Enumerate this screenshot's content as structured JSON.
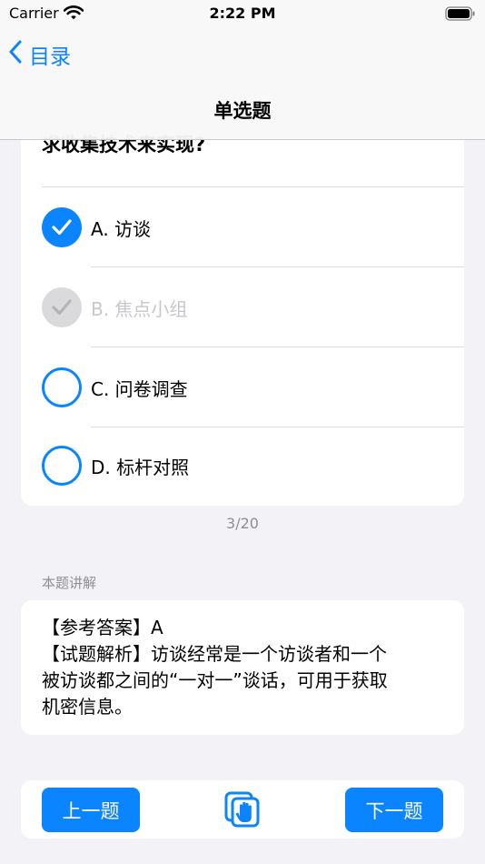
{
  "status_bar": {
    "carrier": "Carrier",
    "time": "2:22 PM"
  },
  "nav": {
    "back_label": "目录",
    "title": "单选题"
  },
  "question": {
    "lines": [
      "求收集技术来实现?"
    ]
  },
  "options": [
    {
      "label": "A. 访谈",
      "state": "checked"
    },
    {
      "label": "B. 焦点小组",
      "state": "disabled"
    },
    {
      "label": "C. 问卷调查",
      "state": "empty"
    },
    {
      "label": "D. 标杆对照",
      "state": "empty"
    }
  ],
  "progress": "3/20",
  "explanation": {
    "header": "本题讲解",
    "lines": [
      "【参考答案】A",
      "【试题解析】访谈经常是一个访谈者和一个",
      "被访谈都之间的“一对一”谈话，可用于获取",
      "机密信息。"
    ]
  },
  "toolbar": {
    "prev_label": "上一题",
    "next_label": "下一题"
  },
  "colors": {
    "accent": "#0a84ff",
    "background": "#f2f2f7",
    "disabled": "#dadadc",
    "secondary_text": "#8e8e93"
  }
}
